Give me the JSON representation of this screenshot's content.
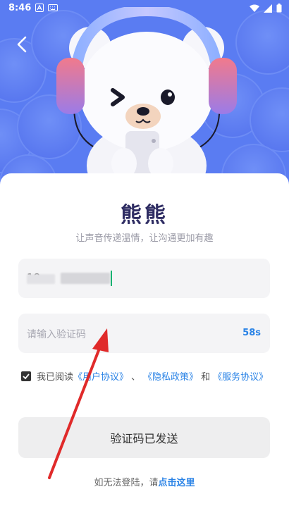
{
  "status_bar": {
    "time": "8:46"
  },
  "header": {
    "back_icon": "chevron-left-icon"
  },
  "app": {
    "name": "熊熊",
    "slogan": "让声音传递温情，让沟通更加有趣"
  },
  "phone_field": {
    "value": "18"
  },
  "code_field": {
    "placeholder": "请输入验证码",
    "countdown": "58s"
  },
  "agreement": {
    "prefix": "我已阅读",
    "user_agreement": "《用户协议》",
    "separator": "、",
    "privacy_policy": "《隐私政策》",
    "conjunction": "和",
    "service_agreement": "《服务协议》",
    "checked": true
  },
  "submit": {
    "label": "验证码已发送"
  },
  "help": {
    "text": "如无法登陆，请",
    "link": "点击这里"
  },
  "colors": {
    "hero": "#5a7cf2",
    "accent": "#2a83e6",
    "title": "#2f2d63",
    "annotation": "#e02a2a"
  }
}
